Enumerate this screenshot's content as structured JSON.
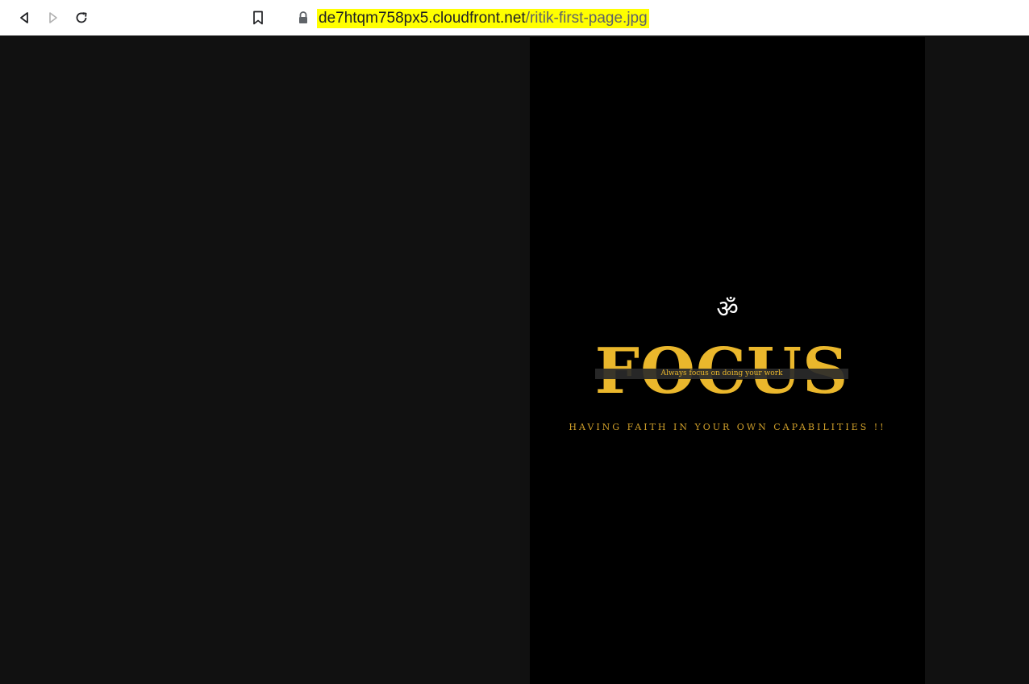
{
  "browser": {
    "icons": {
      "back": "back-arrow-icon",
      "forward": "forward-arrow-icon",
      "reload": "reload-icon",
      "bookmark": "bookmark-icon",
      "lock": "lock-icon"
    },
    "url_host": "de7htqm758px5.cloudfront.net",
    "url_path": "/ritik-first-page.jpg",
    "url_highlight_color": "#ffff00"
  },
  "image": {
    "symbol": "ॐ",
    "headline": "FOCUS",
    "tagline": "Always focus on doing your work",
    "caption": "HAVING FAITH IN YOUR OWN CAPABILITIES !!",
    "accent_color": "#eab72c",
    "background_color": "#000000"
  }
}
